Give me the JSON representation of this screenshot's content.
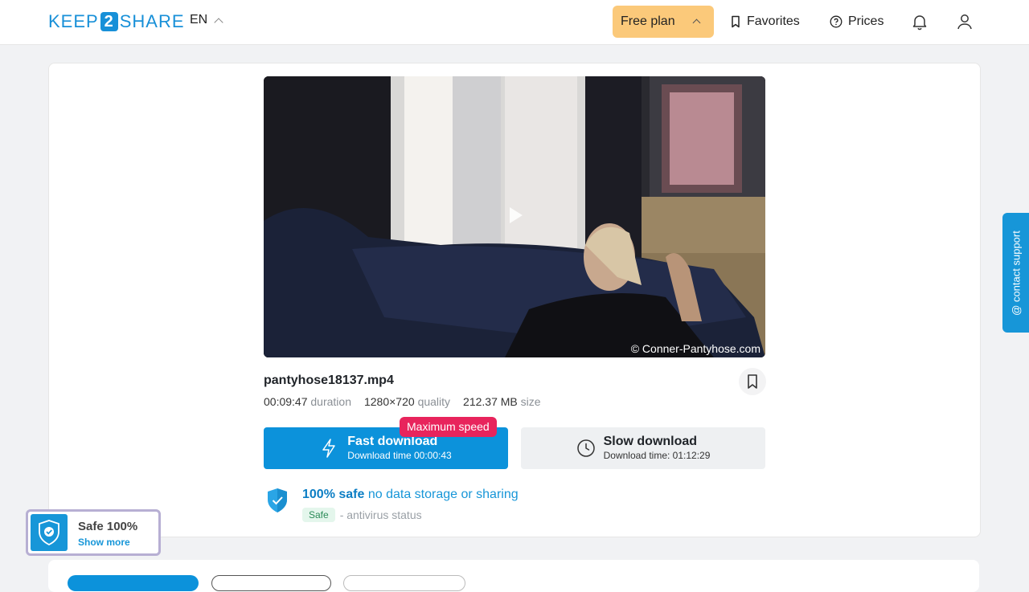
{
  "header": {
    "logo_left": "KEEP",
    "logo_mid": "2",
    "logo_right": "SHARE",
    "language": "EN",
    "plan_label": "Free plan",
    "favorites_label": "Favorites",
    "prices_label": "Prices"
  },
  "file": {
    "name": "pantyhose18137.mp4",
    "watermark": "© Conner-Pantyhose.com",
    "duration_value": "00:09:47",
    "duration_label": "duration",
    "quality_value": "1280×720",
    "quality_label": "quality",
    "size_value": "212.37 MB",
    "size_label": "size"
  },
  "download": {
    "fast_title": "Fast download",
    "fast_sub": "Download time 00:00:43",
    "badge": "Maximum speed",
    "slow_title": "Slow download",
    "slow_sub": "Download time: 01:12:29"
  },
  "safety": {
    "strong": "100% safe",
    "rest": "no data storage or sharing",
    "status_badge": "Safe",
    "status_text": "- antivirus status"
  },
  "support": {
    "label": "@ contact support"
  },
  "widget": {
    "title": "Safe 100%",
    "link": "Show more"
  },
  "colors": {
    "primary": "#0c92db",
    "plan": "#fbc97a",
    "badge": "#e8245c"
  }
}
